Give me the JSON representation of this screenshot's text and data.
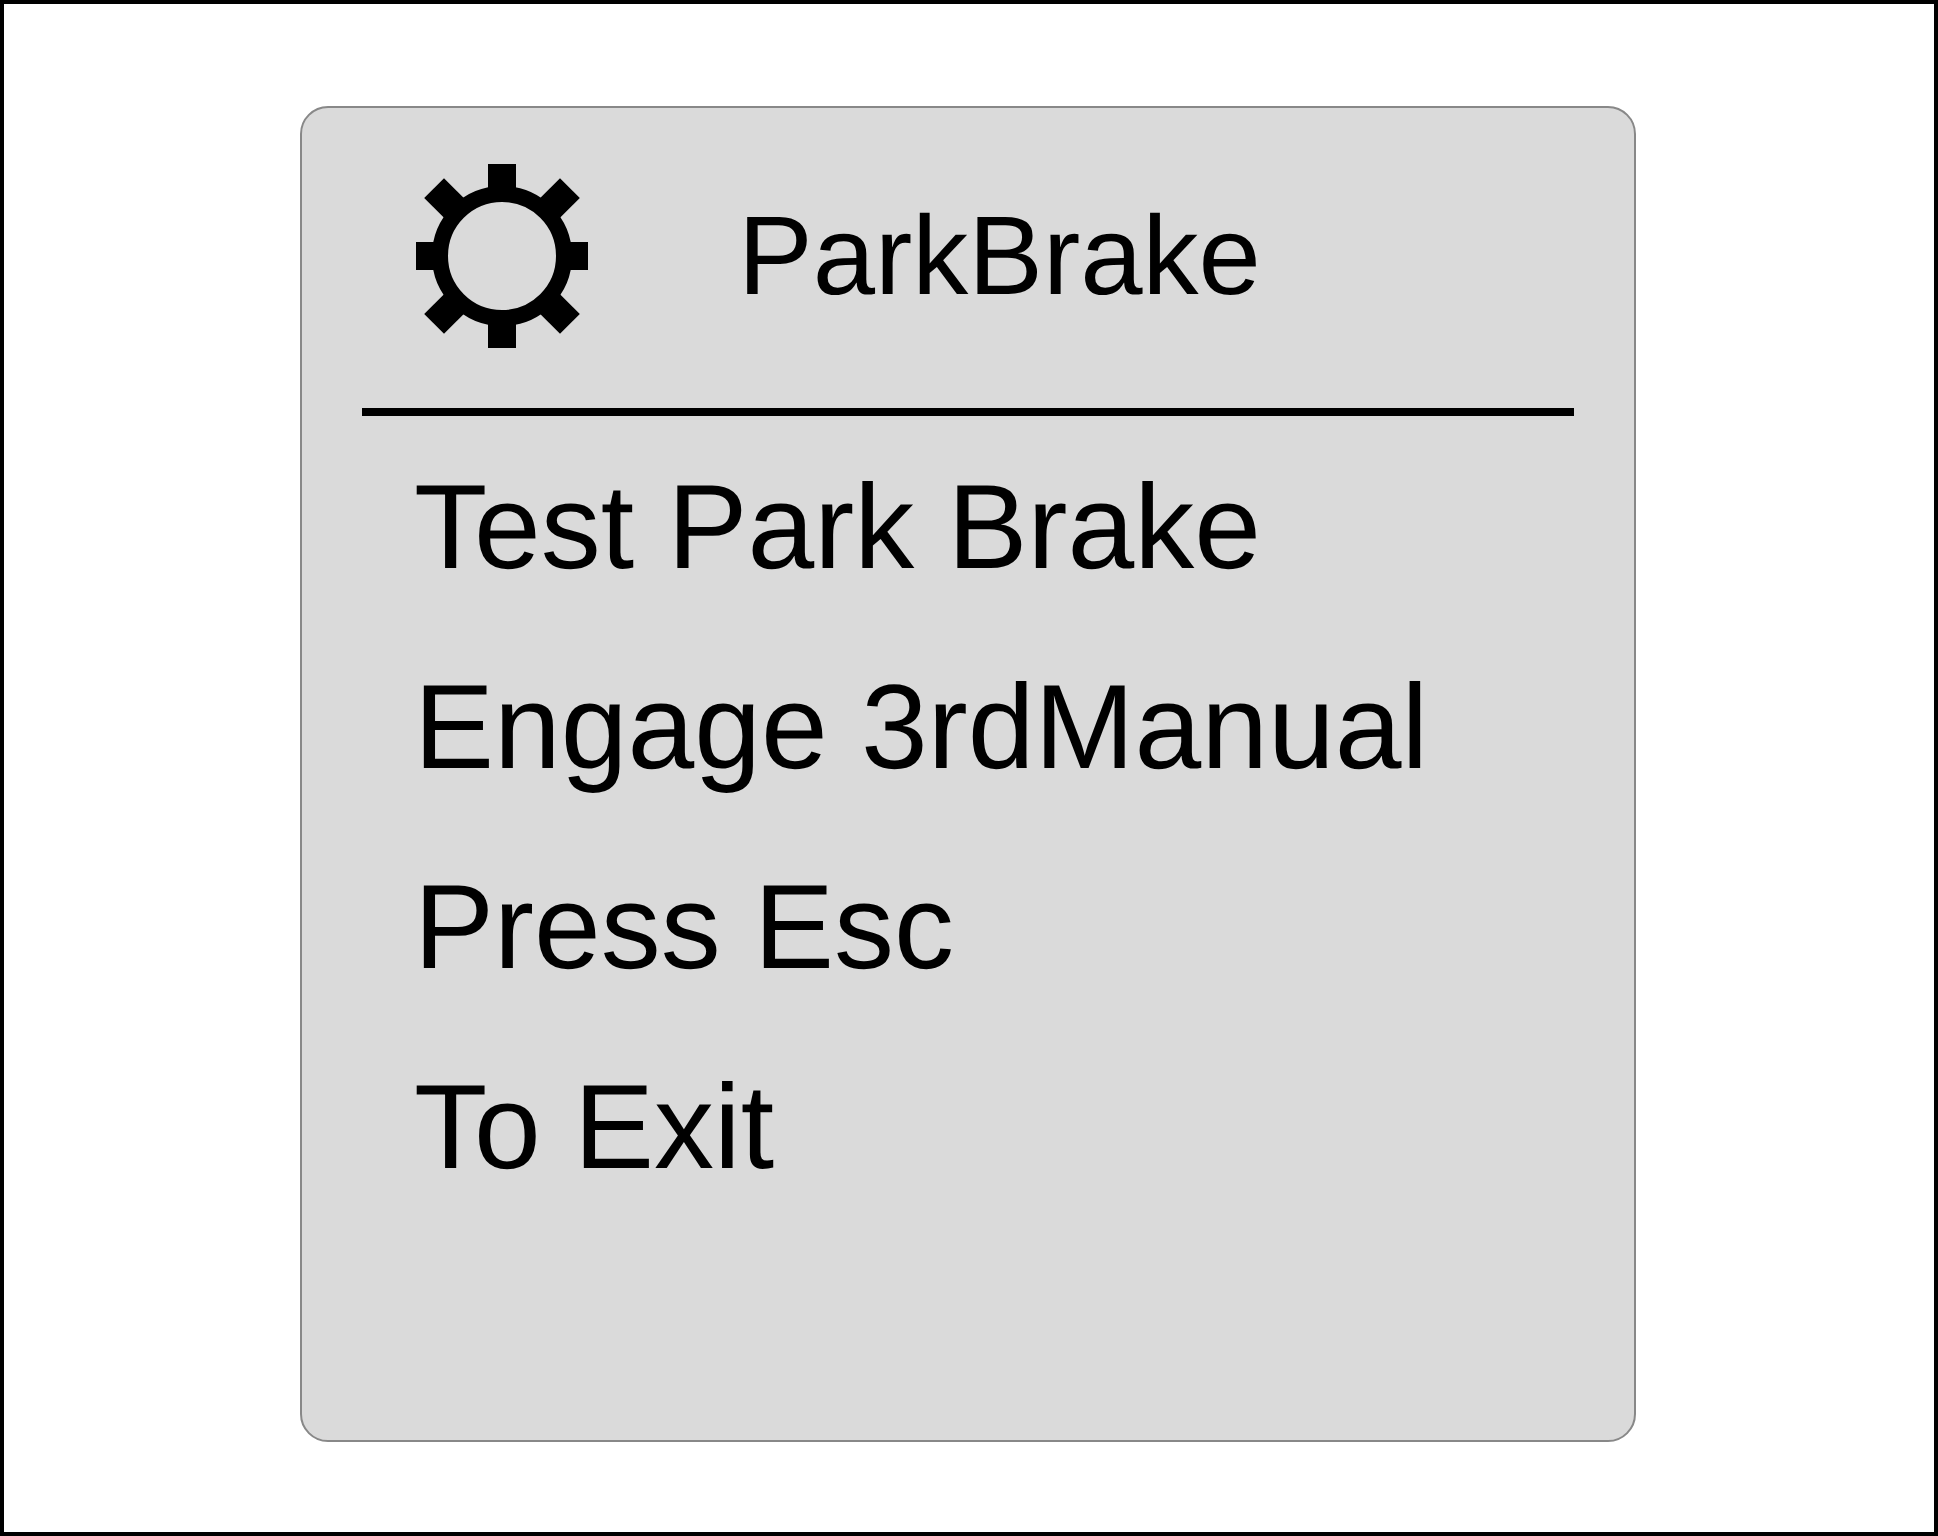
{
  "screen": {
    "title": "ParkBrake",
    "lines": [
      "Test Park Brake",
      "Engage 3rdManual",
      "Press Esc",
      "To Exit"
    ]
  }
}
